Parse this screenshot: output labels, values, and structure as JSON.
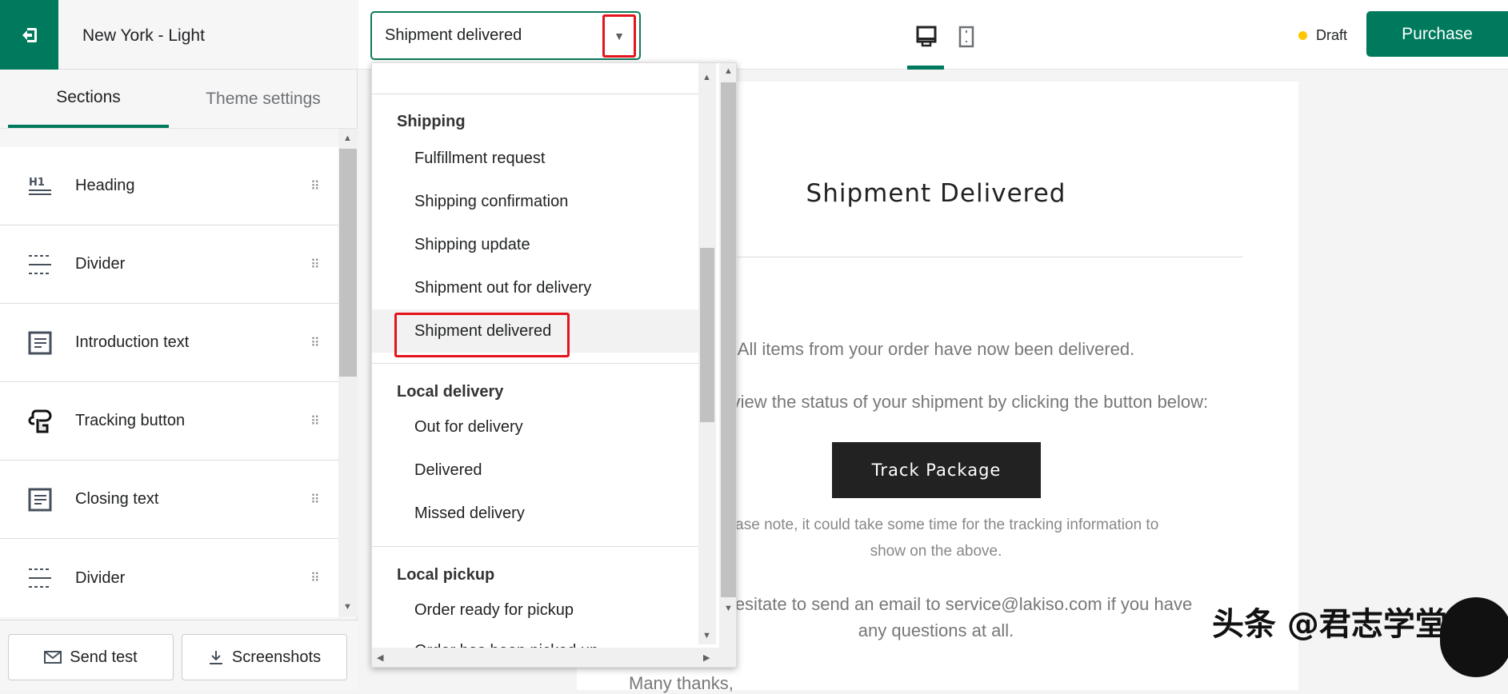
{
  "sidebar": {
    "theme_name": "New York - Light",
    "tabs": [
      {
        "label": "Sections"
      },
      {
        "label": "Theme settings"
      }
    ],
    "items": [
      {
        "label": "Heading",
        "icon": "heading-icon"
      },
      {
        "label": "Divider",
        "icon": "divider-icon"
      },
      {
        "label": "Introduction text",
        "icon": "text-icon"
      },
      {
        "label": "Tracking button",
        "icon": "button-icon"
      },
      {
        "label": "Closing text",
        "icon": "text-icon"
      },
      {
        "label": "Divider",
        "icon": "divider-icon"
      }
    ],
    "send_test": "Send test",
    "screenshots": "Screenshots"
  },
  "toolbar": {
    "template_select": "Shipment delivered",
    "status": "Draft",
    "status_color": "#ffc700",
    "purchase": "Purchase",
    "accent": "#007a5c"
  },
  "dropdown": {
    "groups": [
      {
        "label": "Shipping",
        "items": [
          "Fulfillment request",
          "Shipping confirmation",
          "Shipping update",
          "Shipment out for delivery",
          "Shipment delivered"
        ]
      },
      {
        "label": "Local delivery",
        "items": [
          "Out for delivery",
          "Delivered",
          "Missed delivery"
        ]
      },
      {
        "label": "Local pickup",
        "items": [
          "Order ready for pickup",
          "Order has been picked up"
        ]
      }
    ],
    "selected": "Shipment delivered"
  },
  "email": {
    "title": "Shipment Delivered",
    "line1": "All items from your order have now been delivered.",
    "line2": "You can view the status of your shipment by clicking the button below:",
    "button": "Track Package",
    "note1": "Please note, it could take some time for the tracking information to",
    "note2": "show on the above.",
    "contact1": "Don't hesitate to send an email to service@lakiso.com if you have",
    "contact2": "any questions at all.",
    "signoff": "Many thanks,"
  },
  "watermark": "头条 @君志学堂"
}
